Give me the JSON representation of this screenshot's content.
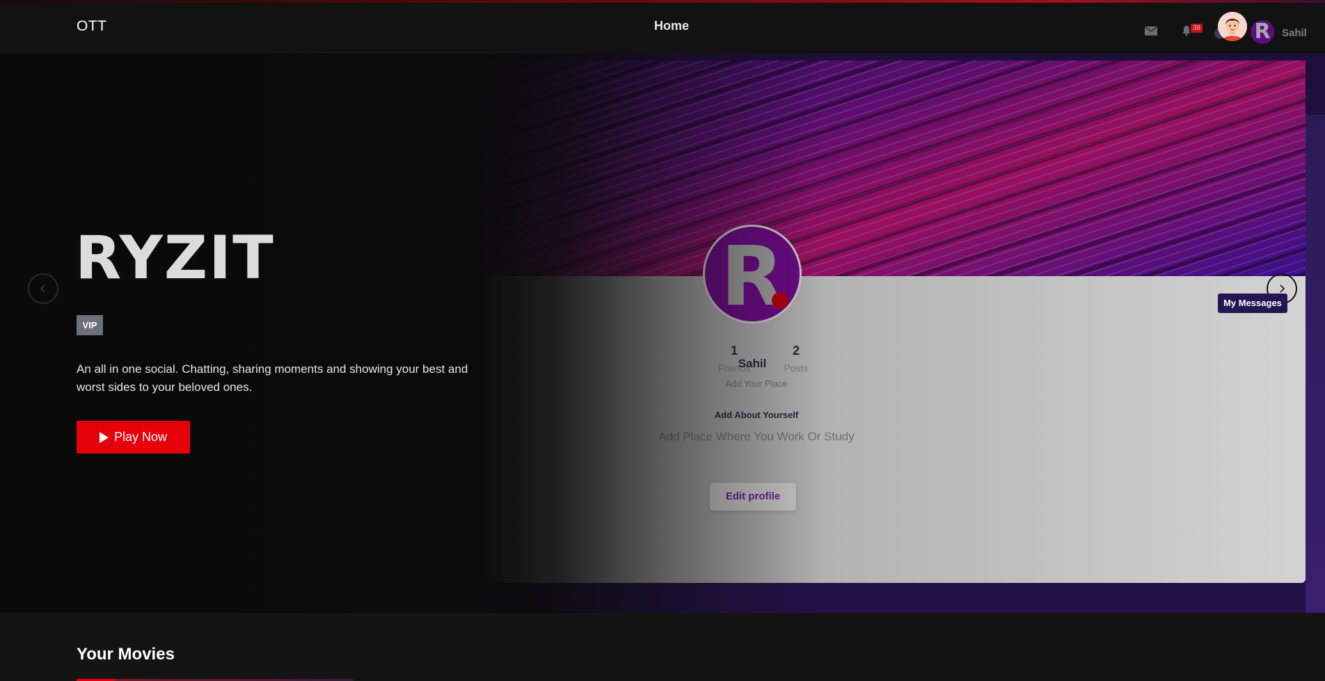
{
  "topbar": {
    "logo": "OTT",
    "nav_home": "Home",
    "notifications_count": "38",
    "username": "Sahil",
    "user_initial": "R"
  },
  "hero": {
    "title": "RYZIT",
    "badge": "VIP",
    "description": "An all in one social. Chatting, sharing moments and showing your best and worst sides to your beloved ones.",
    "play_label": "Play Now",
    "prev_icon": "chevron-left-icon",
    "next_icon": "chevron-right-icon"
  },
  "profile": {
    "avatar_initial": "R",
    "friends_count": "1",
    "friends_label": "Friends",
    "posts_count": "2",
    "posts_label": "Posts",
    "name": "Sahil",
    "place": "Add Your Place",
    "about": "Add About Yourself",
    "work": "Add Place Where You Work Or Study",
    "edit_label": "Edit profile"
  },
  "tooltip": {
    "my_messages": "My Messages"
  },
  "section": {
    "title": "Your Movies"
  },
  "colors": {
    "accent": "#e5000a",
    "profile_purple": "#6a0a82",
    "tooltip_bg": "#241653"
  }
}
